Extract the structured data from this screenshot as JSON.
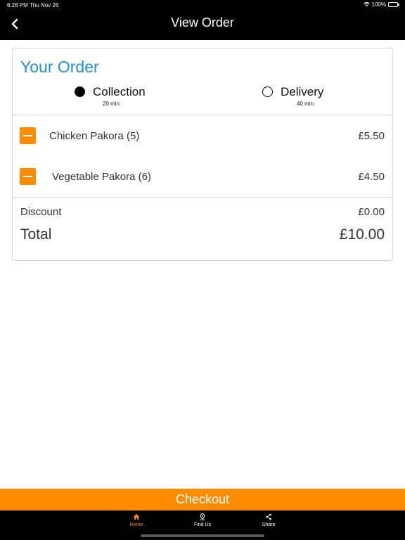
{
  "status_bar": {
    "time": "6:28 PM",
    "date": "Thu Nov 26",
    "battery": "100%"
  },
  "header": {
    "title": "View Order",
    "back_icon": "chevron-left-icon"
  },
  "order": {
    "title": "Your Order",
    "options": [
      {
        "label": "Collection",
        "time": "20 min",
        "selected": true
      },
      {
        "label": "Delivery",
        "time": "40 min",
        "selected": false
      }
    ],
    "items": [
      {
        "name": "Chicken Pakora (5)",
        "price": "£5.50"
      },
      {
        "name": "Vegetable Pakora (6)",
        "price": "£4.50"
      }
    ],
    "discount_label": "Discount",
    "discount_value": "£0.00",
    "total_label": "Total",
    "total_value": "£10.00"
  },
  "checkout_label": "Checkout",
  "tabs": [
    {
      "label": "Home",
      "icon": "home-icon",
      "active": true
    },
    {
      "label": "Find Us",
      "icon": "map-pin-icon",
      "active": false
    },
    {
      "label": "Share",
      "icon": "share-icon",
      "active": false
    }
  ],
  "colors": {
    "accent": "#ff8c00",
    "title_blue": "#1e90d6",
    "header_bg": "#000000"
  }
}
